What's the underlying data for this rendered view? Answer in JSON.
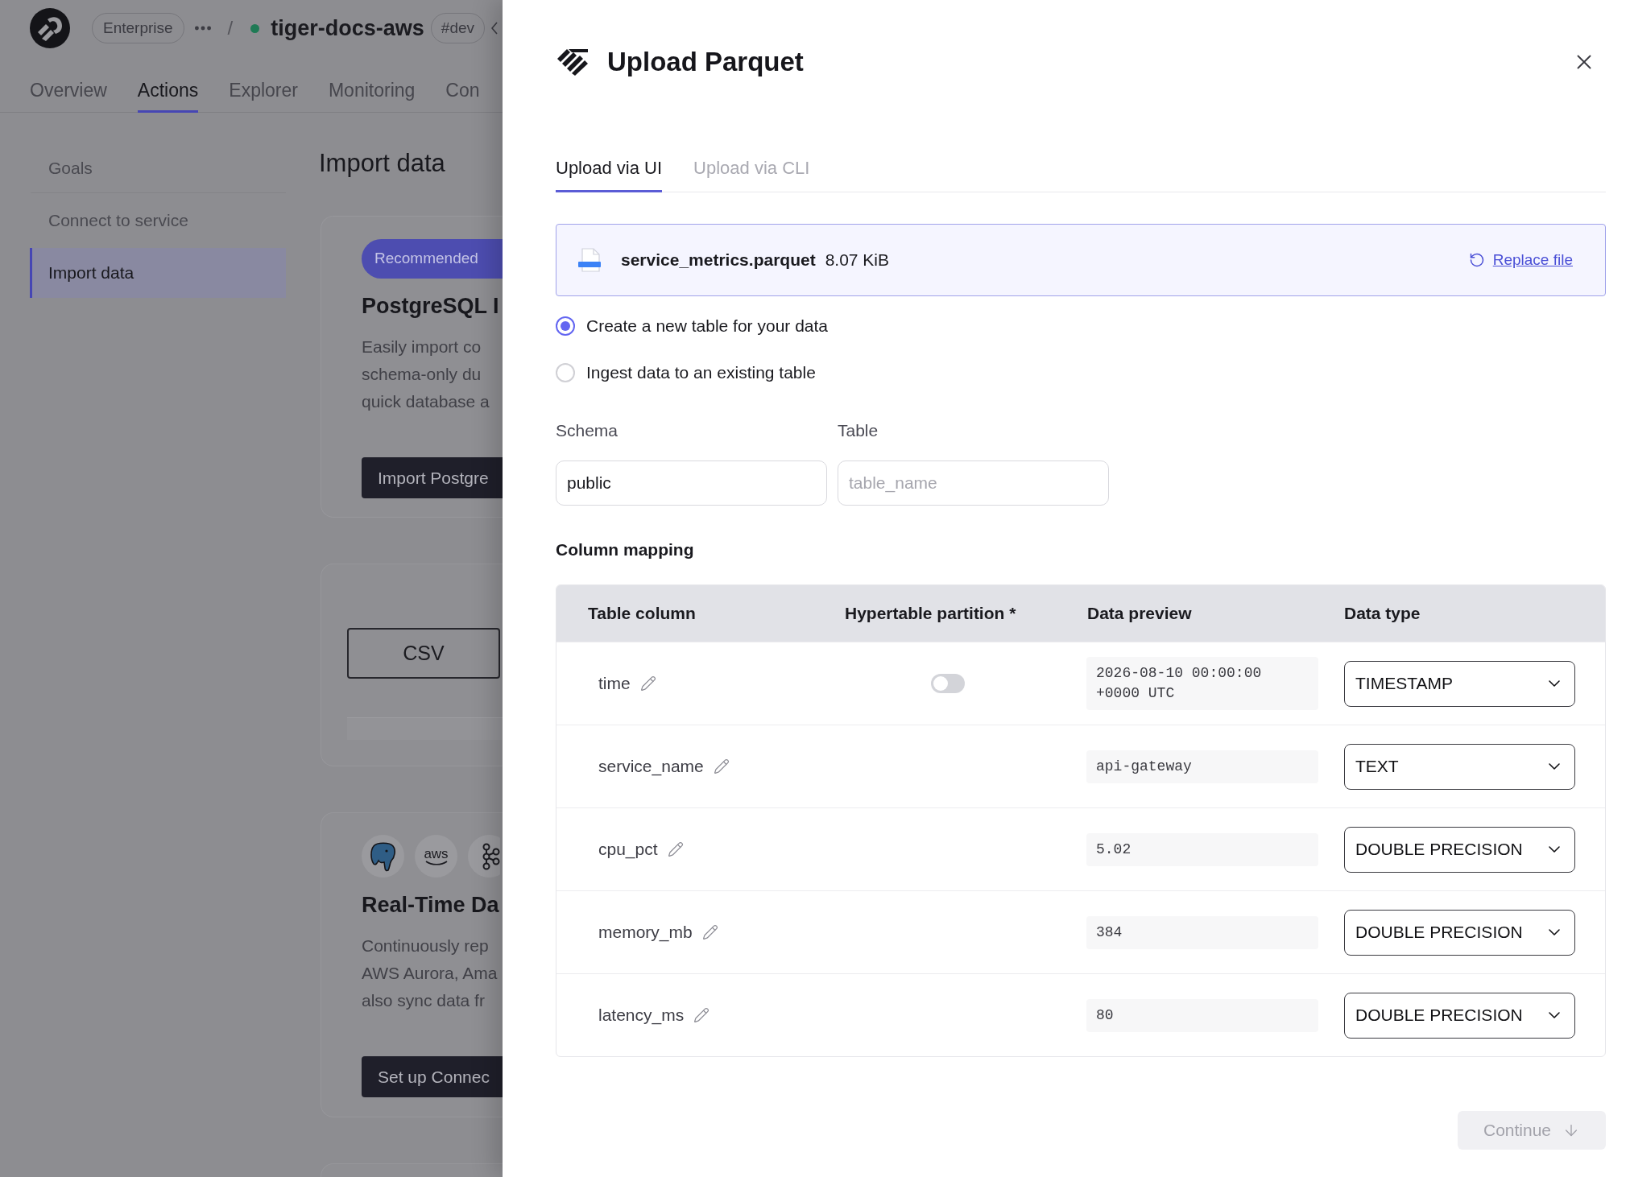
{
  "page": {
    "header": {
      "workspace": "Enterprise",
      "separator": "/",
      "service": {
        "name": "tiger-docs-aws",
        "online": true
      },
      "env": "#dev"
    },
    "nav_tabs": [
      {
        "label": "Overview",
        "selected": false
      },
      {
        "label": "Actions",
        "selected": true
      },
      {
        "label": "Explorer",
        "selected": false
      },
      {
        "label": "Monitoring",
        "selected": false
      },
      {
        "label": "Con",
        "selected": false
      }
    ],
    "sidebar": {
      "items": [
        {
          "label": "Goals",
          "selected": false
        },
        {
          "label": "Connect to service",
          "selected": false
        },
        {
          "label": "Import data",
          "selected": true
        }
      ]
    },
    "title": "Import data",
    "cards": [
      {
        "kind": "feature",
        "badge": "Recommended",
        "title": "PostgreSQL I",
        "description_lines": [
          "Easily import co",
          "schema-only du",
          "quick database a"
        ],
        "button": "Import Postgre"
      },
      {
        "kind": "upload",
        "button": "CSV"
      },
      {
        "kind": "connector",
        "logos": [
          {
            "kind": "elephant"
          },
          {
            "kind": "wordmark",
            "text": "aws"
          },
          {
            "kind": "nodes"
          }
        ],
        "title": "Real-Time Da",
        "description_lines": [
          "Continuously rep",
          "AWS Aurora, Ama",
          "also sync data fr"
        ],
        "button": "Set up Connec"
      },
      {
        "kind": "blank"
      }
    ]
  },
  "drawer": {
    "title": "Upload Parquet",
    "tabs": [
      {
        "label": "Upload via UI",
        "selected": true
      },
      {
        "label": "Upload via CLI",
        "selected": false
      }
    ],
    "file": {
      "name": "service_metrics.parquet",
      "size": "8.07 KiB",
      "action": "Replace file"
    },
    "options": [
      {
        "label": "Create a new table for your data",
        "selected": true
      },
      {
        "label": "Ingest data to an existing table",
        "selected": false
      }
    ],
    "fields": [
      {
        "label": "Schema",
        "value": "public"
      },
      {
        "label": "Table",
        "placeholder": "table_name"
      }
    ],
    "mapping": {
      "title": "Column mapping",
      "columns": [
        "Table column",
        "Hypertable partition *",
        "Data preview",
        "Data type"
      ],
      "rows": [
        {
          "name": "time",
          "partition": {
            "on": false
          },
          "preview": "2026-08-10 00:00:00 +0000 UTC",
          "type": "TIMESTAMP"
        },
        {
          "name": "service_name",
          "preview": "api-gateway",
          "type": "TEXT"
        },
        {
          "name": "cpu_pct",
          "preview": "5.02",
          "type": "DOUBLE PRECISION"
        },
        {
          "name": "memory_mb",
          "preview": "384",
          "type": "DOUBLE PRECISION"
        },
        {
          "name": "latency_ms",
          "preview": "80",
          "type": "DOUBLE PRECISION"
        }
      ]
    },
    "continue": {
      "label": "Continue",
      "disabled": true
    }
  }
}
